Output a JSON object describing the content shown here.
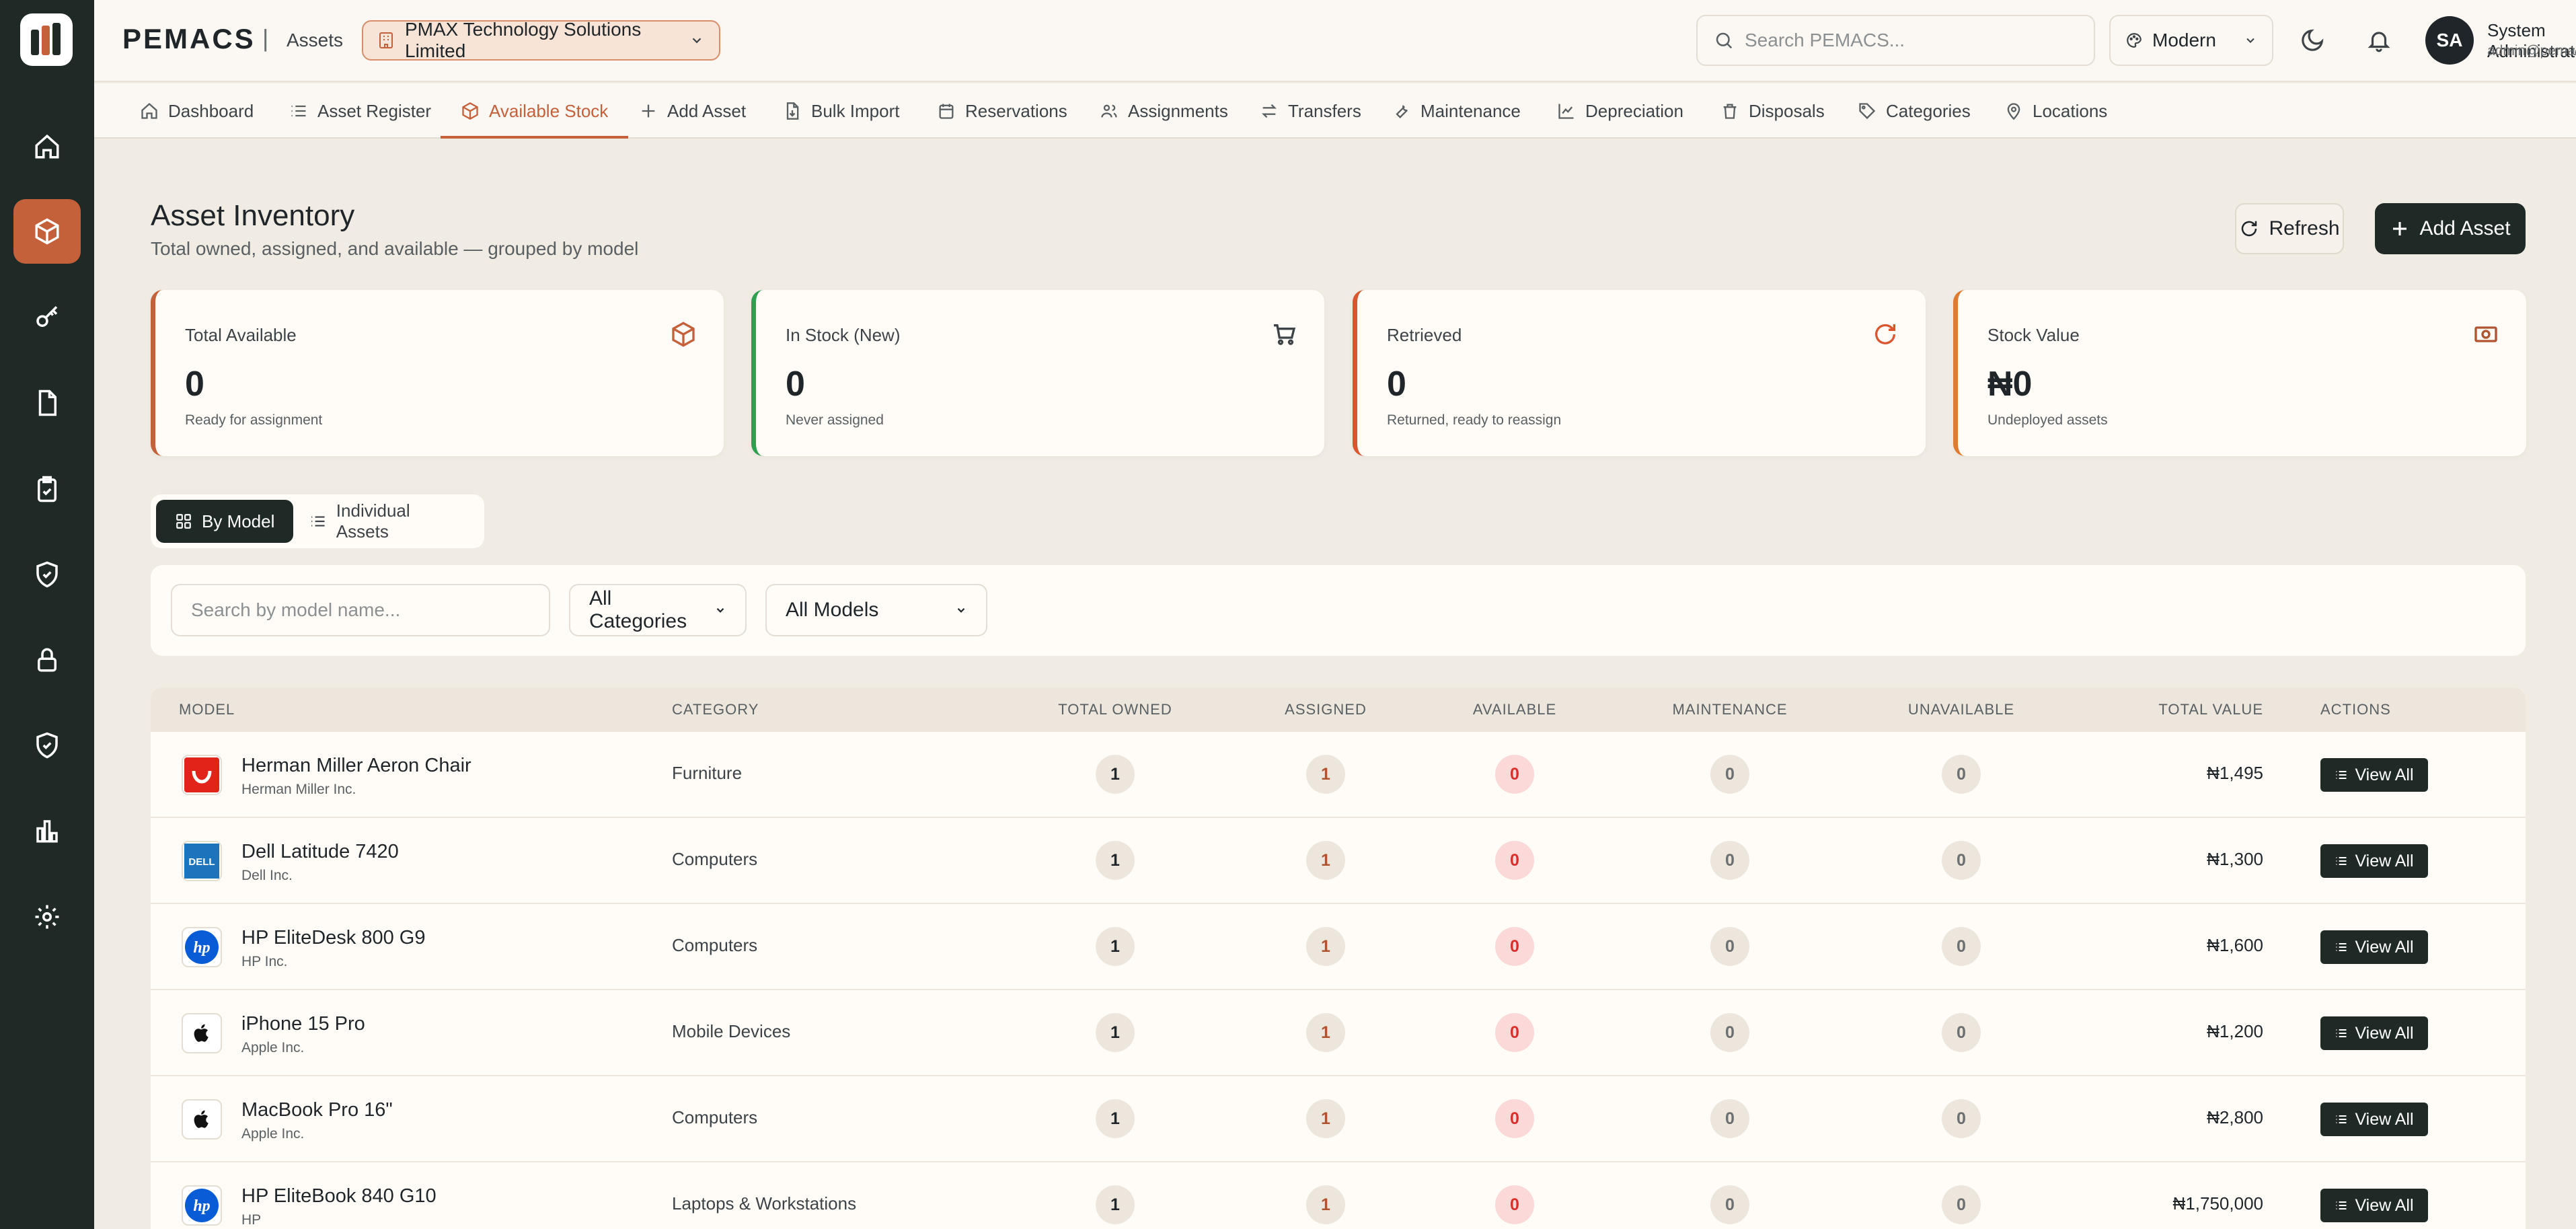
{
  "app": {
    "brand": "PEMACS",
    "separator": "|",
    "section": "Assets",
    "company": "PMAX Technology Solutions Limited"
  },
  "header": {
    "search_placeholder": "Search PEMACS...",
    "theme": "Modern",
    "avatar_initials": "SA",
    "user_name": "System Administrator",
    "user_email": "admin@pemacs.com"
  },
  "rail": {
    "items": [
      "home-icon",
      "box-icon",
      "key-icon",
      "document-icon",
      "clipboard-check-icon",
      "shield-icon",
      "lock-icon",
      "shield-check-icon",
      "bar-chart-icon",
      "gear-icon"
    ],
    "active_index": 1
  },
  "tabs": [
    {
      "label": "Dashboard",
      "icon": "home-icon"
    },
    {
      "label": "Asset Register",
      "icon": "list-icon"
    },
    {
      "label": "Available Stock",
      "icon": "box-icon",
      "active": true
    },
    {
      "label": "Add Asset",
      "icon": "plus-icon"
    },
    {
      "label": "Bulk Import",
      "icon": "file-import-icon"
    },
    {
      "label": "Reservations",
      "icon": "calendar-icon"
    },
    {
      "label": "Assignments",
      "icon": "users-icon"
    },
    {
      "label": "Transfers",
      "icon": "transfer-icon"
    },
    {
      "label": "Maintenance",
      "icon": "wrench-icon"
    },
    {
      "label": "Depreciation",
      "icon": "chart-line-icon"
    },
    {
      "label": "Disposals",
      "icon": "trash-icon"
    },
    {
      "label": "Categories",
      "icon": "tag-icon"
    },
    {
      "label": "Locations",
      "icon": "pin-icon"
    }
  ],
  "page": {
    "title": "Asset Inventory",
    "subtitle": "Total owned, assigned, and available — grouped by model",
    "refresh_label": "Refresh",
    "add_label": "Add Asset"
  },
  "stats": [
    {
      "label": "Total Available",
      "value": "0",
      "note": "Ready for assignment",
      "icon": "box-icon",
      "accent": "#c4603a"
    },
    {
      "label": "In Stock (New)",
      "value": "0",
      "note": "Never assigned",
      "icon": "cart-icon",
      "accent": "#2fa04f"
    },
    {
      "label": "Retrieved",
      "value": "0",
      "note": "Returned, ready to reassign",
      "icon": "refresh-icon",
      "accent": "#d9562e"
    },
    {
      "label": "Stock Value",
      "value": "₦0",
      "note": "Undeployed assets",
      "icon": "money-icon",
      "accent": "#e07a2e"
    }
  ],
  "view_toggle": {
    "by_model": "By Model",
    "individual": "Individual Assets",
    "active": "by_model"
  },
  "filters": {
    "search_placeholder": "Search by model name...",
    "category": "All Categories",
    "model": "All Models"
  },
  "table": {
    "headers": {
      "model": "MODEL",
      "category": "CATEGORY",
      "total_owned": "TOTAL OWNED",
      "assigned": "ASSIGNED",
      "available": "AVAILABLE",
      "maintenance": "MAINTENANCE",
      "unavailable": "UNAVAILABLE",
      "total_value": "TOTAL VALUE",
      "actions": "ACTIONS"
    },
    "action_label": "View All",
    "rows": [
      {
        "model": "Herman Miller Aeron Chair",
        "maker": "Herman Miller Inc.",
        "logo": "herman-miller-logo",
        "category": "Furniture",
        "total_owned": "1",
        "assigned": "1",
        "available": "0",
        "maintenance": "0",
        "unavailable": "0",
        "total_value": "₦1,495"
      },
      {
        "model": "Dell Latitude 7420",
        "maker": "Dell Inc.",
        "logo": "dell-logo",
        "category": "Computers",
        "total_owned": "1",
        "assigned": "1",
        "available": "0",
        "maintenance": "0",
        "unavailable": "0",
        "total_value": "₦1,300"
      },
      {
        "model": "HP EliteDesk 800 G9",
        "maker": "HP Inc.",
        "logo": "hp-logo",
        "category": "Computers",
        "total_owned": "1",
        "assigned": "1",
        "available": "0",
        "maintenance": "0",
        "unavailable": "0",
        "total_value": "₦1,600"
      },
      {
        "model": "iPhone 15 Pro",
        "maker": "Apple Inc.",
        "logo": "apple-logo",
        "category": "Mobile Devices",
        "total_owned": "1",
        "assigned": "1",
        "available": "0",
        "maintenance": "0",
        "unavailable": "0",
        "total_value": "₦1,200"
      },
      {
        "model": "MacBook Pro 16\"",
        "maker": "Apple Inc.",
        "logo": "apple-logo",
        "category": "Computers",
        "total_owned": "1",
        "assigned": "1",
        "available": "0",
        "maintenance": "0",
        "unavailable": "0",
        "total_value": "₦2,800"
      },
      {
        "model": "HP EliteBook 840 G10",
        "maker": "HP",
        "logo": "hp-logo",
        "category": "Laptops & Workstations",
        "total_owned": "1",
        "assigned": "1",
        "available": "0",
        "maintenance": "0",
        "unavailable": "0",
        "total_value": "₦1,750,000"
      }
    ]
  },
  "colors": {
    "accent": "#c4603a",
    "dark": "#1f2a27",
    "background": "#f0ebe3",
    "available_badge": "#fbd9d8"
  }
}
